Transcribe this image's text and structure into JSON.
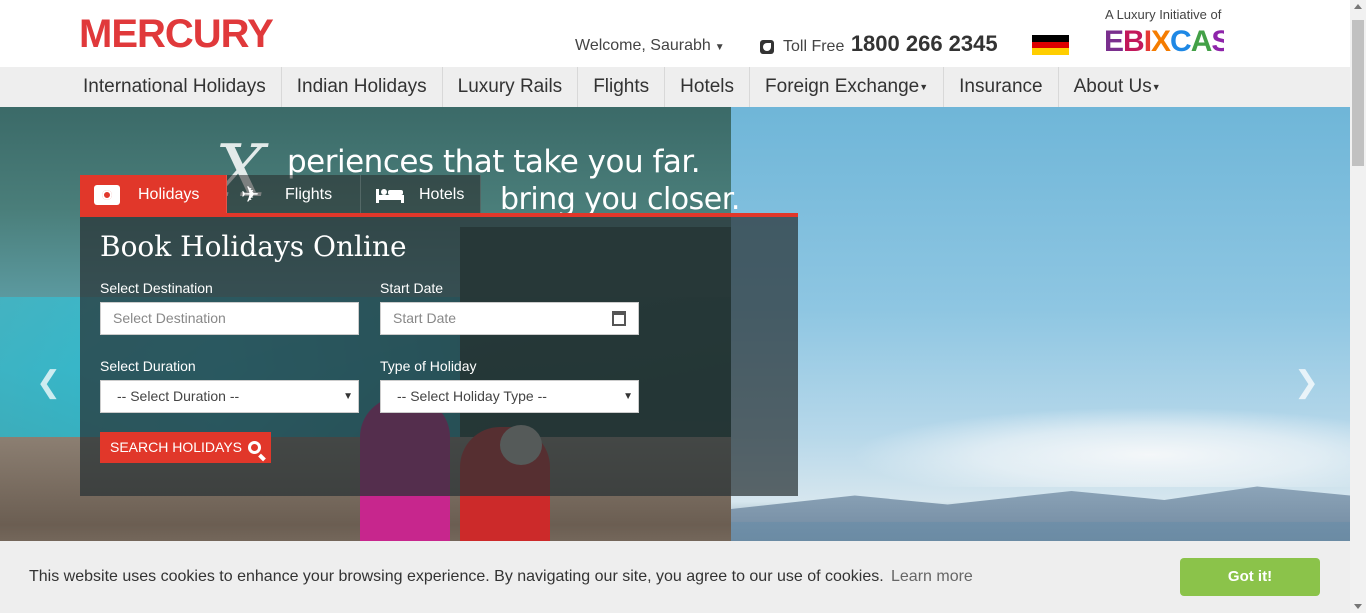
{
  "header": {
    "logo": "MERCURY",
    "welcome": "Welcome, Saurabh",
    "tollfree_label": "Toll Free",
    "tollfree_number": "1800 266 2345",
    "initiative_text": "A Luxury Initiative of",
    "partner_logo": "EBIXCASH"
  },
  "nav": {
    "items": [
      {
        "label": "International Holidays"
      },
      {
        "label": "Indian Holidays"
      },
      {
        "label": "Luxury Rails"
      },
      {
        "label": "Flights"
      },
      {
        "label": "Hotels"
      },
      {
        "label": "Foreign Exchange"
      },
      {
        "label": "Insurance"
      },
      {
        "label": "About Us"
      }
    ]
  },
  "hero": {
    "tagline_line1": "periences that take you far.",
    "tagline_line2": "bring you closer."
  },
  "booking": {
    "tabs": [
      {
        "label": "Holidays",
        "icon": "camera-icon"
      },
      {
        "label": "Flights",
        "icon": "plane-icon"
      },
      {
        "label": "Hotels",
        "icon": "bed-icon"
      }
    ],
    "title": "Book Holidays Online",
    "destination_label": "Select Destination",
    "destination_placeholder": "Select Destination",
    "start_date_label": "Start Date",
    "start_date_placeholder": "Start Date",
    "duration_label": "Select Duration",
    "duration_value": "-- Select Duration --",
    "holiday_type_label": "Type of Holiday",
    "holiday_type_value": "-- Select Holiday Type --",
    "search_button": "SEARCH HOLIDAYS"
  },
  "cookie": {
    "text": "This website uses cookies to enhance your browsing experience. By navigating our site, you agree to our use of cookies.",
    "learn_more": "Learn more",
    "accept": "Got it!"
  },
  "colors": {
    "brand_red": "#e0393b",
    "accent_red": "#e1372a",
    "accept_green": "#8bc34a"
  }
}
